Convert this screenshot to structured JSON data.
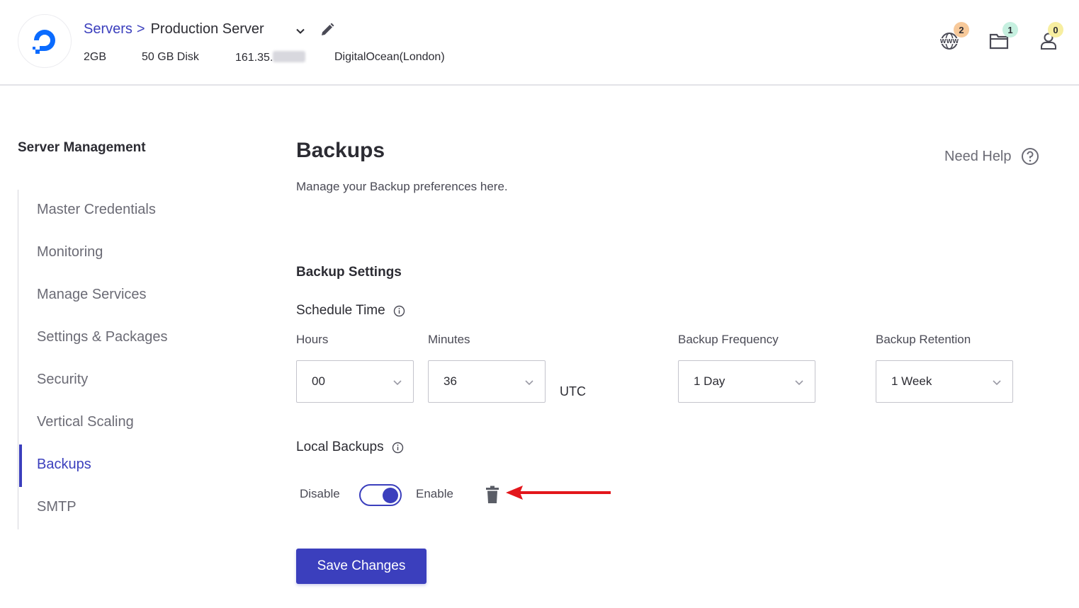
{
  "header": {
    "breadcrumb": {
      "parent": "Servers",
      "separator": ">",
      "current": "Production Server"
    },
    "server_meta": {
      "ram": "2GB",
      "disk": "50 GB Disk",
      "ip": "161.35.",
      "location": "DigitalOcean(London)"
    },
    "icons": [
      {
        "name": "www-icon",
        "badge": "2",
        "badge_color": "#f7c99a"
      },
      {
        "name": "folder-icon",
        "badge": "1",
        "badge_color": "#c6f0e0"
      },
      {
        "name": "user-icon",
        "badge": "0",
        "badge_color": "#f7eea0"
      }
    ]
  },
  "sidebar": {
    "title": "Server Management",
    "items": [
      {
        "label": "Master Credentials",
        "active": false
      },
      {
        "label": "Monitoring",
        "active": false
      },
      {
        "label": "Manage Services",
        "active": false
      },
      {
        "label": "Settings & Packages",
        "active": false
      },
      {
        "label": "Security",
        "active": false
      },
      {
        "label": "Vertical Scaling",
        "active": false
      },
      {
        "label": "Backups",
        "active": true
      },
      {
        "label": "SMTP",
        "active": false
      }
    ]
  },
  "main": {
    "title": "Backups",
    "subtitle": "Manage your Backup preferences here.",
    "help_label": "Need Help",
    "section_title": "Backup Settings",
    "schedule_label": "Schedule Time",
    "hours": {
      "label": "Hours",
      "value": "00"
    },
    "minutes": {
      "label": "Minutes",
      "value": "36"
    },
    "timezone": "UTC",
    "frequency": {
      "label": "Backup Frequency",
      "value": "1 Day"
    },
    "retention": {
      "label": "Backup Retention",
      "value": "1 Week"
    },
    "local_backups": {
      "label": "Local Backups",
      "disable_label": "Disable",
      "enable_label": "Enable",
      "enabled": true
    },
    "save_label": "Save Changes"
  },
  "colors": {
    "accent": "#3b3fbd",
    "annotation_arrow": "#e3161b"
  }
}
